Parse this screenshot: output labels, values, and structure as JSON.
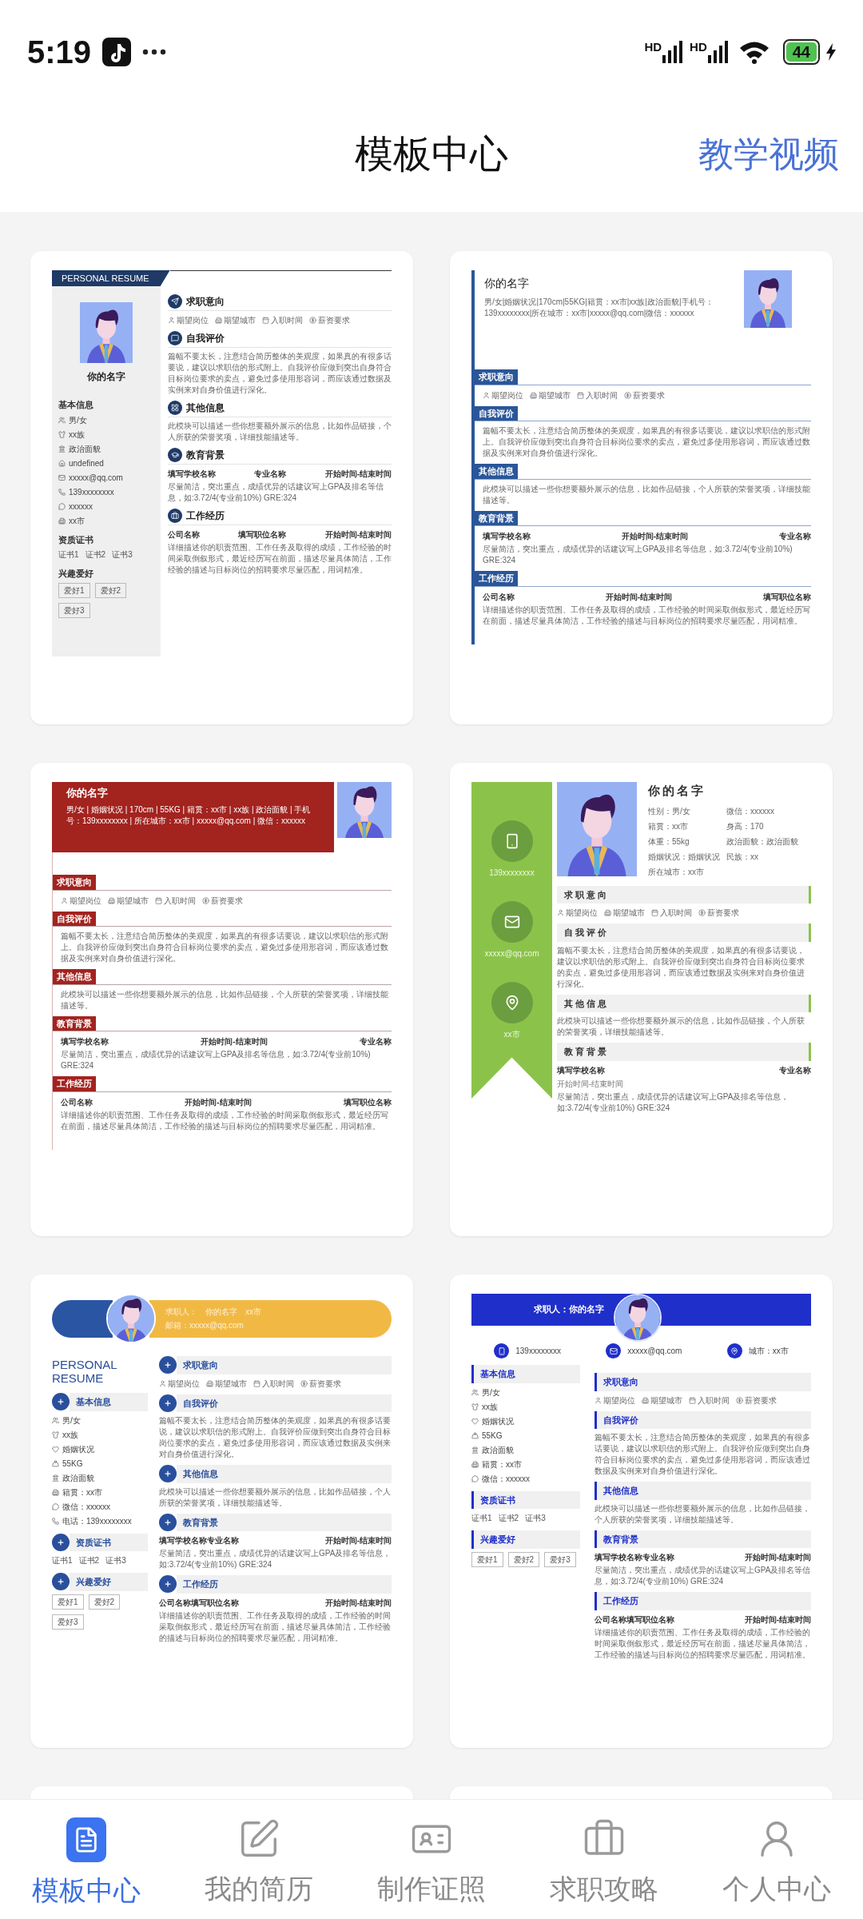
{
  "status_bar": {
    "time": "5:19",
    "network": [
      "HD",
      "HD"
    ],
    "battery": "44"
  },
  "header": {
    "title": "模板中心",
    "action": "教学视频"
  },
  "templates": [
    {
      "kind": "navy-sidebar",
      "banner_title": "PERSONAL RESUME",
      "name": "你的名字",
      "side": [
        {
          "title": "基本信息",
          "kind": "list",
          "items": [
            {
              "kind": "gender",
              "text": "男/女"
            },
            {
              "kind": "ethnicity",
              "text": "xx族"
            },
            {
              "kind": "politics",
              "text": "政治面貌"
            },
            {
              "kind": "home",
              "text": "undefined"
            },
            {
              "kind": "email",
              "text": "xxxxx@qq.com"
            },
            {
              "kind": "phone",
              "text": "139xxxxxxxx"
            },
            {
              "kind": "wechat",
              "text": "xxxxxx"
            },
            {
              "kind": "city",
              "text": "xx市"
            }
          ]
        },
        {
          "title": "资质证书",
          "kind": "certs",
          "items": [
            "证书1",
            "证书2",
            "证书3"
          ]
        },
        {
          "title": "兴趣爱好",
          "kind": "tags",
          "items": [
            "爱好1",
            "爱好2",
            "爱好3"
          ]
        }
      ],
      "sections": [
        {
          "title": "求职意向",
          "kind": "intent",
          "items": [
            "期望岗位",
            "期望城市",
            "入职时间",
            "薪资要求"
          ]
        },
        {
          "title": "自我评价",
          "kind": "text",
          "text": "篇幅不要太长，注意结合简历整体的美观度，如果真的有很多话要说，建议以求职信的形式附上。自我评价应做到突出自身符合目标岗位要求的卖点，避免过多使用形容词，而应该通过数据及实例来对自身价值进行深化。"
        },
        {
          "title": "其他信息",
          "kind": "text",
          "text": "此模块可以描述一些你想要额外展示的信息，比如作品链接，个人所获的荣誉奖项，详细技能描述等。"
        },
        {
          "title": "教育背景",
          "kind": "entry",
          "columns": [
            "填写学校名称",
            "专业名称",
            "开始时间-结束时间"
          ],
          "text": "尽量简洁，突出重点，成绩优异的话建议写上GPA及排名等信息，如:3.72/4(专业前10%) GRE:324"
        },
        {
          "title": "工作经历",
          "kind": "entry",
          "columns": [
            "公司名称",
            "填写职位名称",
            "开始时间-结束时间"
          ],
          "text": "详细描述你的职责范围、工作任务及取得的成绩，工作经验的时间采取倒叙形式，最近经历写在前面，描述尽量具体简洁，工作经验的描述与目标岗位的招聘要求尽量匹配，用词精准。"
        }
      ]
    },
    {
      "kind": "left-rule",
      "name": "你的名字",
      "info": "男/女|婚姻状况|170cm|55KG|籍贯：xx市|xx族|政治面貌|手机号：139xxxxxxxx|所在城市：xx市|xxxxx@qq.com|微信：xxxxxx",
      "sections": [
        {
          "title": "求职意向",
          "kind": "intent",
          "items": [
            "期望岗位",
            "期望城市",
            "入职时间",
            "薪资要求"
          ]
        },
        {
          "title": "自我评价",
          "kind": "text",
          "text": "篇幅不要太长，注意结合简历整体的美观度，如果真的有很多话要说，建议以求职信的形式附上。自我评价应做到突出自身符合目标岗位要求的卖点，避免过多使用形容词，而应该通过数据及实例来对自身价值进行深化。"
        },
        {
          "title": "其他信息",
          "kind": "text",
          "text": "此模块可以描述一些你想要额外展示的信息，比如作品链接，个人所获的荣誉奖项，详细技能描述等。"
        },
        {
          "title": "教育背景",
          "kind": "entry",
          "columns": [
            "填写学校名称",
            "开始时间-结束时间",
            "专业名称"
          ],
          "text": "尽量简洁，突出重点，成绩优异的话建议写上GPA及排名等信息，如:3.72/4(专业前10%) GRE:324"
        },
        {
          "title": "工作经历",
          "kind": "entry",
          "columns": [
            "公司名称",
            "开始时间-结束时间",
            "填写职位名称"
          ],
          "text": "详细描述你的职责范围、工作任务及取得的成绩，工作经验的时间采取倒叙形式，最近经历写在前面，描述尽量具体简洁，工作经验的描述与目标岗位的招聘要求尽量匹配，用词精准。"
        }
      ]
    },
    {
      "kind": "red-banner",
      "name": "你的名字",
      "info": "男/女 | 婚姻状况 | 170cm | 55KG | 籍贯：xx市 | xx族 | 政治面貌 | 手机号：139xxxxxxxx | 所在城市：xx市 | xxxxx@qq.com | 微信：xxxxxx",
      "sections": [
        {
          "title": "求职意向",
          "kind": "intent",
          "items": [
            "期望岗位",
            "期望城市",
            "入职时间",
            "薪资要求"
          ]
        },
        {
          "title": "自我评价",
          "kind": "text",
          "text": "篇幅不要太长，注意结合简历整体的美观度，如果真的有很多话要说，建议以求职信的形式附上。自我评价应做到突出自身符合目标岗位要求的卖点，避免过多使用形容词，而应该通过数据及实例来对自身价值进行深化。"
        },
        {
          "title": "其他信息",
          "kind": "text",
          "text": "此模块可以描述一些你想要额外展示的信息，比如作品链接，个人所获的荣誉奖项，详细技能描述等。"
        },
        {
          "title": "教育背景",
          "kind": "entry",
          "columns": [
            "填写学校名称",
            "开始时间-结束时间",
            "专业名称"
          ],
          "text": "尽量简洁，突出重点，成绩优异的话建议写上GPA及排名等信息，如:3.72/4(专业前10%) GRE:324"
        },
        {
          "title": "工作经历",
          "kind": "entry",
          "columns": [
            "公司名称",
            "开始时间-结束时间",
            "填写职位名称"
          ],
          "text": "详细描述你的职责范围、工作任务及取得的成绩，工作经验的时间采取倒叙形式，最近经历写在前面，描述尽量具体简洁，工作经验的描述与目标岗位的招聘要求尽量匹配，用词精准。"
        }
      ]
    },
    {
      "kind": "green-ribbon",
      "name": "你的名字",
      "contacts": [
        {
          "kind": "phone",
          "text": "139xxxxxxxx"
        },
        {
          "kind": "email",
          "text": "xxxxx@qq.com"
        },
        {
          "kind": "location",
          "text": "xx市"
        }
      ],
      "info_items": [
        "性别：男/女",
        "微信：xxxxxx",
        "籍贯：xx市",
        "身高：170",
        "体重：55kg",
        "政治面貌：政治面貌",
        "婚姻状况：婚姻状况",
        "民族：xx",
        "所在城市：xx市"
      ],
      "sections": [
        {
          "title": "求职意向",
          "kind": "intent",
          "items": [
            "期望岗位",
            "期望城市",
            "入职时间",
            "薪资要求"
          ]
        },
        {
          "title": "自我评价",
          "kind": "text",
          "text": "篇幅不要太长，注意结合简历整体的美观度，如果真的有很多话要说，建议以求职信的形式附上。自我评价应做到突出自身符合目标岗位要求的卖点，避免过多使用形容词，而应该通过数据及实例来对自身价值进行深化。"
        },
        {
          "title": "其他信息",
          "kind": "text",
          "text": "此模块可以描述一些你想要额外展示的信息，比如作品链接，个人所获的荣誉奖项，详细技能描述等。"
        },
        {
          "title": "教育背景",
          "kind": "entry",
          "columns": [
            "填写学校名称",
            "专业名称",
            "开始时间-结束时间"
          ],
          "text": "尽量简洁，突出重点，成绩优异的话建议写上GPA及排名等信息，如:3.72/4(专业前10%) GRE:324"
        }
      ]
    },
    {
      "kind": "pill-header",
      "banner_items": [
        "求职人：",
        "你的名字",
        "xx市"
      ],
      "banner_email": "邮箱：xxxxx@qq.com",
      "title": "PERSONAL RESUME",
      "side": [
        {
          "title": "基本信息",
          "kind": "list",
          "items": [
            {
              "kind": "gender",
              "text": "男/女"
            },
            {
              "kind": "ethnicity",
              "text": "xx族"
            },
            {
              "kind": "marriage",
              "text": "婚姻状况"
            },
            {
              "kind": "weight",
              "text": "55KG"
            },
            {
              "kind": "politics",
              "text": "政治面貌"
            },
            {
              "kind": "origin",
              "text": "籍贯：xx市"
            },
            {
              "kind": "wechat",
              "text": "微信：xxxxxx"
            },
            {
              "kind": "phone",
              "text": "电话：139xxxxxxxx"
            }
          ]
        },
        {
          "title": "资质证书",
          "kind": "certs",
          "items": [
            "证书1",
            "证书2",
            "证书3"
          ]
        },
        {
          "title": "兴趣爱好",
          "kind": "tags",
          "items": [
            "爱好1",
            "爱好2",
            "爱好3"
          ]
        }
      ],
      "sections": [
        {
          "title": "求职意向",
          "kind": "intent",
          "items": [
            "期望岗位",
            "期望城市",
            "入职时间",
            "薪资要求"
          ]
        },
        {
          "title": "自我评价",
          "kind": "text",
          "text": "篇幅不要太长，注意结合简历整体的美观度，如果真的有很多话要说，建议以求职信的形式附上。自我评价应做到突出自身符合目标岗位要求的卖点，避免过多使用形容词，而应该通过数据及实例来对自身价值进行深化。"
        },
        {
          "title": "其他信息",
          "kind": "text",
          "text": "此模块可以描述一些你想要额外展示的信息，比如作品链接，个人所获的荣誉奖项，详细技能描述等。"
        },
        {
          "title": "教育背景",
          "kind": "entry",
          "columns": [
            "填写学校名称专业名称",
            "开始时间-结束时间"
          ],
          "text": "尽量简洁，突出重点，成绩优异的话建议写上GPA及排名等信息，如:3.72/4(专业前10%) GRE:324"
        },
        {
          "title": "工作经历",
          "kind": "entry",
          "columns": [
            "公司名称填写职位名称",
            "开始时间-结束时间"
          ],
          "text": "详细描述你的职责范围、工作任务及取得的成绩，工作经验的时间采取倒叙形式，最近经历写在前面，描述尽量具体简洁，工作经验的描述与目标岗位的招聘要求尽量匹配，用词精准。"
        }
      ]
    },
    {
      "kind": "blue-band",
      "banner": "求职人：你的名字",
      "contacts": [
        {
          "kind": "phone",
          "text": "139xxxxxxxx"
        },
        {
          "kind": "email",
          "text": "xxxxx@qq.com"
        },
        {
          "kind": "location",
          "text": "城市：xx市"
        }
      ],
      "side": [
        {
          "title": "基本信息",
          "kind": "list",
          "items": [
            {
              "kind": "gender",
              "text": "男/女"
            },
            {
              "kind": "ethnicity",
              "text": "xx族"
            },
            {
              "kind": "marriage",
              "text": "婚姻状况"
            },
            {
              "kind": "weight",
              "text": "55KG"
            },
            {
              "kind": "politics",
              "text": "政治面貌"
            },
            {
              "kind": "origin",
              "text": "籍贯：xx市"
            },
            {
              "kind": "wechat",
              "text": "微信：xxxxxx"
            }
          ]
        },
        {
          "title": "资质证书",
          "kind": "certs",
          "items": [
            "证书1",
            "证书2",
            "证书3"
          ]
        },
        {
          "title": "兴趣爱好",
          "kind": "tags",
          "items": [
            "爱好1",
            "爱好2",
            "爱好3"
          ]
        }
      ],
      "sections": [
        {
          "title": "求职意向",
          "kind": "intent",
          "items": [
            "期望岗位",
            "期望城市",
            "入职时间",
            "薪资要求"
          ]
        },
        {
          "title": "自我评价",
          "kind": "text",
          "text": "篇幅不要太长，注意结合简历整体的美观度，如果真的有很多话要说，建议以求职信的形式附上。自我评价应做到突出自身符合目标岗位要求的卖点，避免过多使用形容词，而应该通过数据及实例来对自身价值进行深化。"
        },
        {
          "title": "其他信息",
          "kind": "text",
          "text": "此模块可以描述一些你想要额外展示的信息，比如作品链接，个人所获的荣誉奖项，详细技能描述等。"
        },
        {
          "title": "教育背景",
          "kind": "entry",
          "columns": [
            "填写学校名称专业名称",
            "开始时间-结束时间"
          ],
          "text": "尽量简洁，突出重点，成绩优异的话建议写上GPA及排名等信息，如:3.72/4(专业前10%) GRE:324"
        },
        {
          "title": "工作经历",
          "kind": "entry",
          "columns": [
            "公司名称填写职位名称",
            "开始时间-结束时间"
          ],
          "text": "详细描述你的职责范围、工作任务及取得的成绩，工作经验的时间采取倒叙形式，最近经历写在前面，描述尽量具体简洁，工作经验的描述与目标岗位的招聘要求尽量匹配，用词精准。"
        }
      ]
    },
    {
      "kind": "partial"
    },
    {
      "kind": "partial"
    }
  ],
  "tab_bar": {
    "tabs": [
      {
        "label": "模板中心",
        "selected": true
      },
      {
        "label": "我的简历",
        "selected": false
      },
      {
        "label": "制作证照",
        "selected": false
      },
      {
        "label": "求职攻略",
        "selected": false
      },
      {
        "label": "个人中心",
        "selected": false
      }
    ]
  }
}
